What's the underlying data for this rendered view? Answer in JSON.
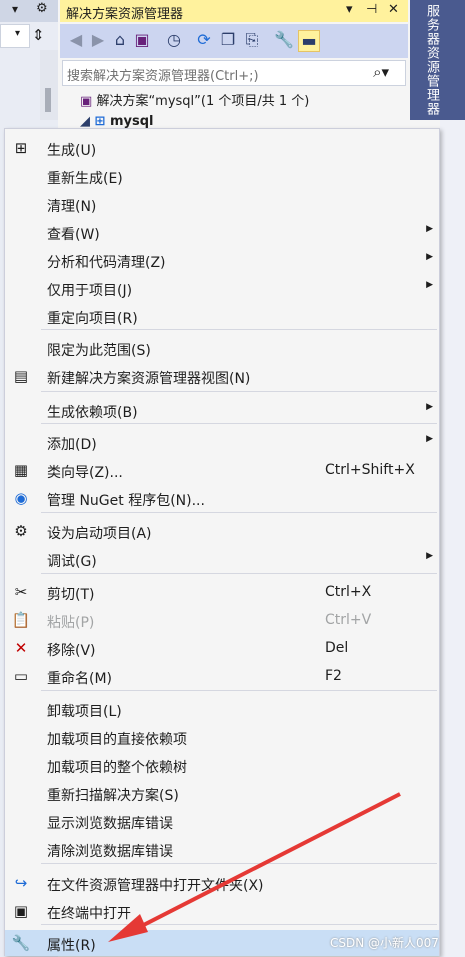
{
  "explorer": {
    "title": "解决方案资源管理器",
    "pin": "▾ ⊣ ✕",
    "search_placeholder": "搜索解决方案资源管理器(Ctrl+;)",
    "solution_row": "解决方案“mysql”(1 个项目/共 1 个)",
    "project_row": "mysql"
  },
  "side_tab": "服务器资源管理器",
  "menu": {
    "items": [
      {
        "label": "生成(U)",
        "icon": "build-icon"
      },
      {
        "label": "重新生成(E)"
      },
      {
        "label": "清理(N)"
      },
      {
        "label": "查看(W)",
        "submenu": true
      },
      {
        "label": "分析和代码清理(Z)",
        "submenu": true
      },
      {
        "label": "仅用于项目(J)",
        "submenu": true
      },
      {
        "label": "重定向项目(R)"
      },
      {
        "label": "限定为此范围(S)"
      },
      {
        "label": "新建解决方案资源管理器视图(N)",
        "icon": "new-view-icon"
      },
      {
        "label": "生成依赖项(B)",
        "submenu": true
      },
      {
        "label": "添加(D)",
        "submenu": true
      },
      {
        "label": "类向导(Z)...",
        "icon": "class-wizard-icon",
        "shortcut": "Ctrl+Shift+X"
      },
      {
        "label": "管理 NuGet 程序包(N)...",
        "icon": "nuget-icon"
      },
      {
        "label": "设为启动项目(A)",
        "icon": "gear-icon"
      },
      {
        "label": "调试(G)",
        "submenu": true
      },
      {
        "label": "剪切(T)",
        "icon": "cut-icon",
        "shortcut": "Ctrl+X"
      },
      {
        "label": "粘贴(P)",
        "icon": "paste-icon",
        "shortcut": "Ctrl+V",
        "disabled": true
      },
      {
        "label": "移除(V)",
        "icon": "remove-icon",
        "shortcut": "Del"
      },
      {
        "label": "重命名(M)",
        "icon": "rename-icon",
        "shortcut": "F2"
      },
      {
        "label": "卸载项目(L)"
      },
      {
        "label": "加载项目的直接依赖项"
      },
      {
        "label": "加载项目的整个依赖树"
      },
      {
        "label": "重新扫描解决方案(S)"
      },
      {
        "label": "显示浏览数据库错误"
      },
      {
        "label": "清除浏览数据库错误"
      },
      {
        "label": "在文件资源管理器中打开文件夹(X)",
        "icon": "open-folder-icon"
      },
      {
        "label": "在终端中打开",
        "icon": "terminal-icon"
      },
      {
        "label": "属性(R)",
        "icon": "wrench-icon"
      }
    ]
  },
  "watermark": "CSDN @小新人007"
}
